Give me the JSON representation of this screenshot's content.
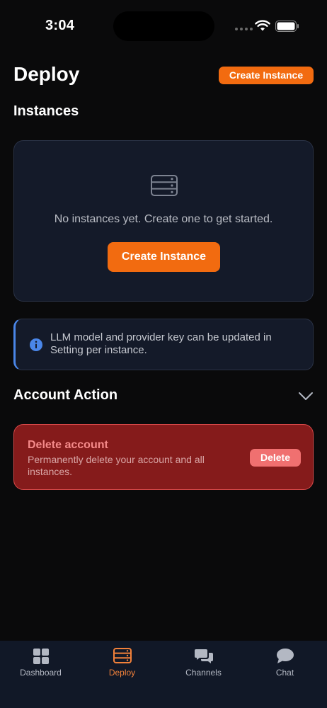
{
  "status_bar": {
    "time": "3:04"
  },
  "header": {
    "title": "Deploy",
    "create_button": "Create Instance"
  },
  "instances": {
    "section_title": "Instances",
    "empty_text": "No instances yet. Create one to get started.",
    "create_button": "Create Instance"
  },
  "info_banner": {
    "text": "LLM model and provider key can be updated in Setting per instance."
  },
  "account_action": {
    "title": "Account Action",
    "delete_title": "Delete account",
    "delete_description": "Permanently delete your account and all instances.",
    "delete_button": "Delete"
  },
  "tabs": [
    {
      "label": "Dashboard",
      "icon": "grid-icon",
      "active": false
    },
    {
      "label": "Deploy",
      "icon": "server-icon",
      "active": true
    },
    {
      "label": "Channels",
      "icon": "chat-bubbles-icon",
      "active": false
    },
    {
      "label": "Chat",
      "icon": "chat-icon",
      "active": false
    }
  ],
  "colors": {
    "accent": "#f26b10",
    "background": "#0a0a0b",
    "card": "#141a29",
    "danger": "#851b1b",
    "info": "#4a86e8"
  }
}
